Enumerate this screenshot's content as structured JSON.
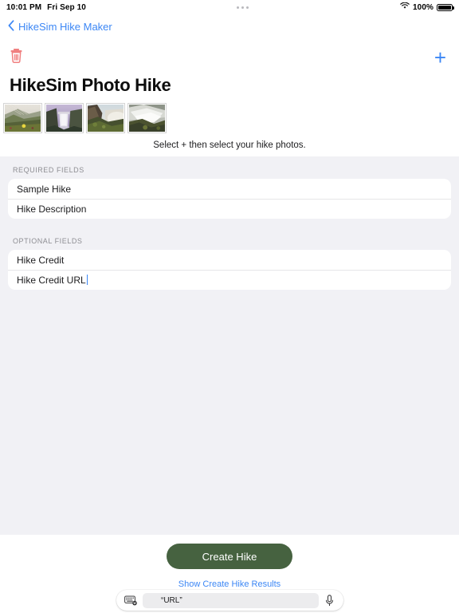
{
  "status_bar": {
    "time": "10:01 PM",
    "date": "Fri Sep 10",
    "battery_percent": "100%",
    "wifi_icon": "wifi-icon",
    "battery_icon": "battery-icon",
    "more_icon": "multitasking-dots-icon"
  },
  "nav": {
    "back_label": "HikeSim Hike Maker",
    "back_icon": "chevron-left-icon",
    "accent_color": "#3c87f5"
  },
  "toolbar": {
    "delete_icon": "trash-icon",
    "delete_color": "#f08080",
    "add_label": "+",
    "add_icon": "plus-icon"
  },
  "page_title": "HikeSim Photo Hike",
  "photos": [
    {
      "name": "hike-photo-1",
      "alt": "coastal hillside with wildflowers"
    },
    {
      "name": "hike-photo-2",
      "alt": "tall waterfall in purple light"
    },
    {
      "name": "hike-photo-3",
      "alt": "cliffside waterfall and mist"
    },
    {
      "name": "hike-photo-4",
      "alt": "cascading rapids over mossy rocks"
    }
  ],
  "hint_text": "Select + then select your hike photos.",
  "sections": [
    {
      "header": "REQUIRED FIELDS",
      "rows": [
        {
          "name": "hike-name-field",
          "value": "Sample Hike",
          "caret": false
        },
        {
          "name": "hike-description-field",
          "value": "Hike Description",
          "caret": false
        }
      ]
    },
    {
      "header": "OPTIONAL FIELDS",
      "rows": [
        {
          "name": "hike-credit-field",
          "value": "Hike Credit",
          "caret": false
        },
        {
          "name": "hike-credit-url-field",
          "value": "Hike Credit URL",
          "caret": true
        }
      ]
    }
  ],
  "footer": {
    "create_label": "Create Hike",
    "create_color": "#466240",
    "results_link": "Show Create Hike Results"
  },
  "keyboard_bar": {
    "keyboard_icon": "keyboard-dismiss-icon",
    "mic_icon": "microphone-icon",
    "suggestions": [
      "“URL”",
      "",
      ""
    ]
  }
}
